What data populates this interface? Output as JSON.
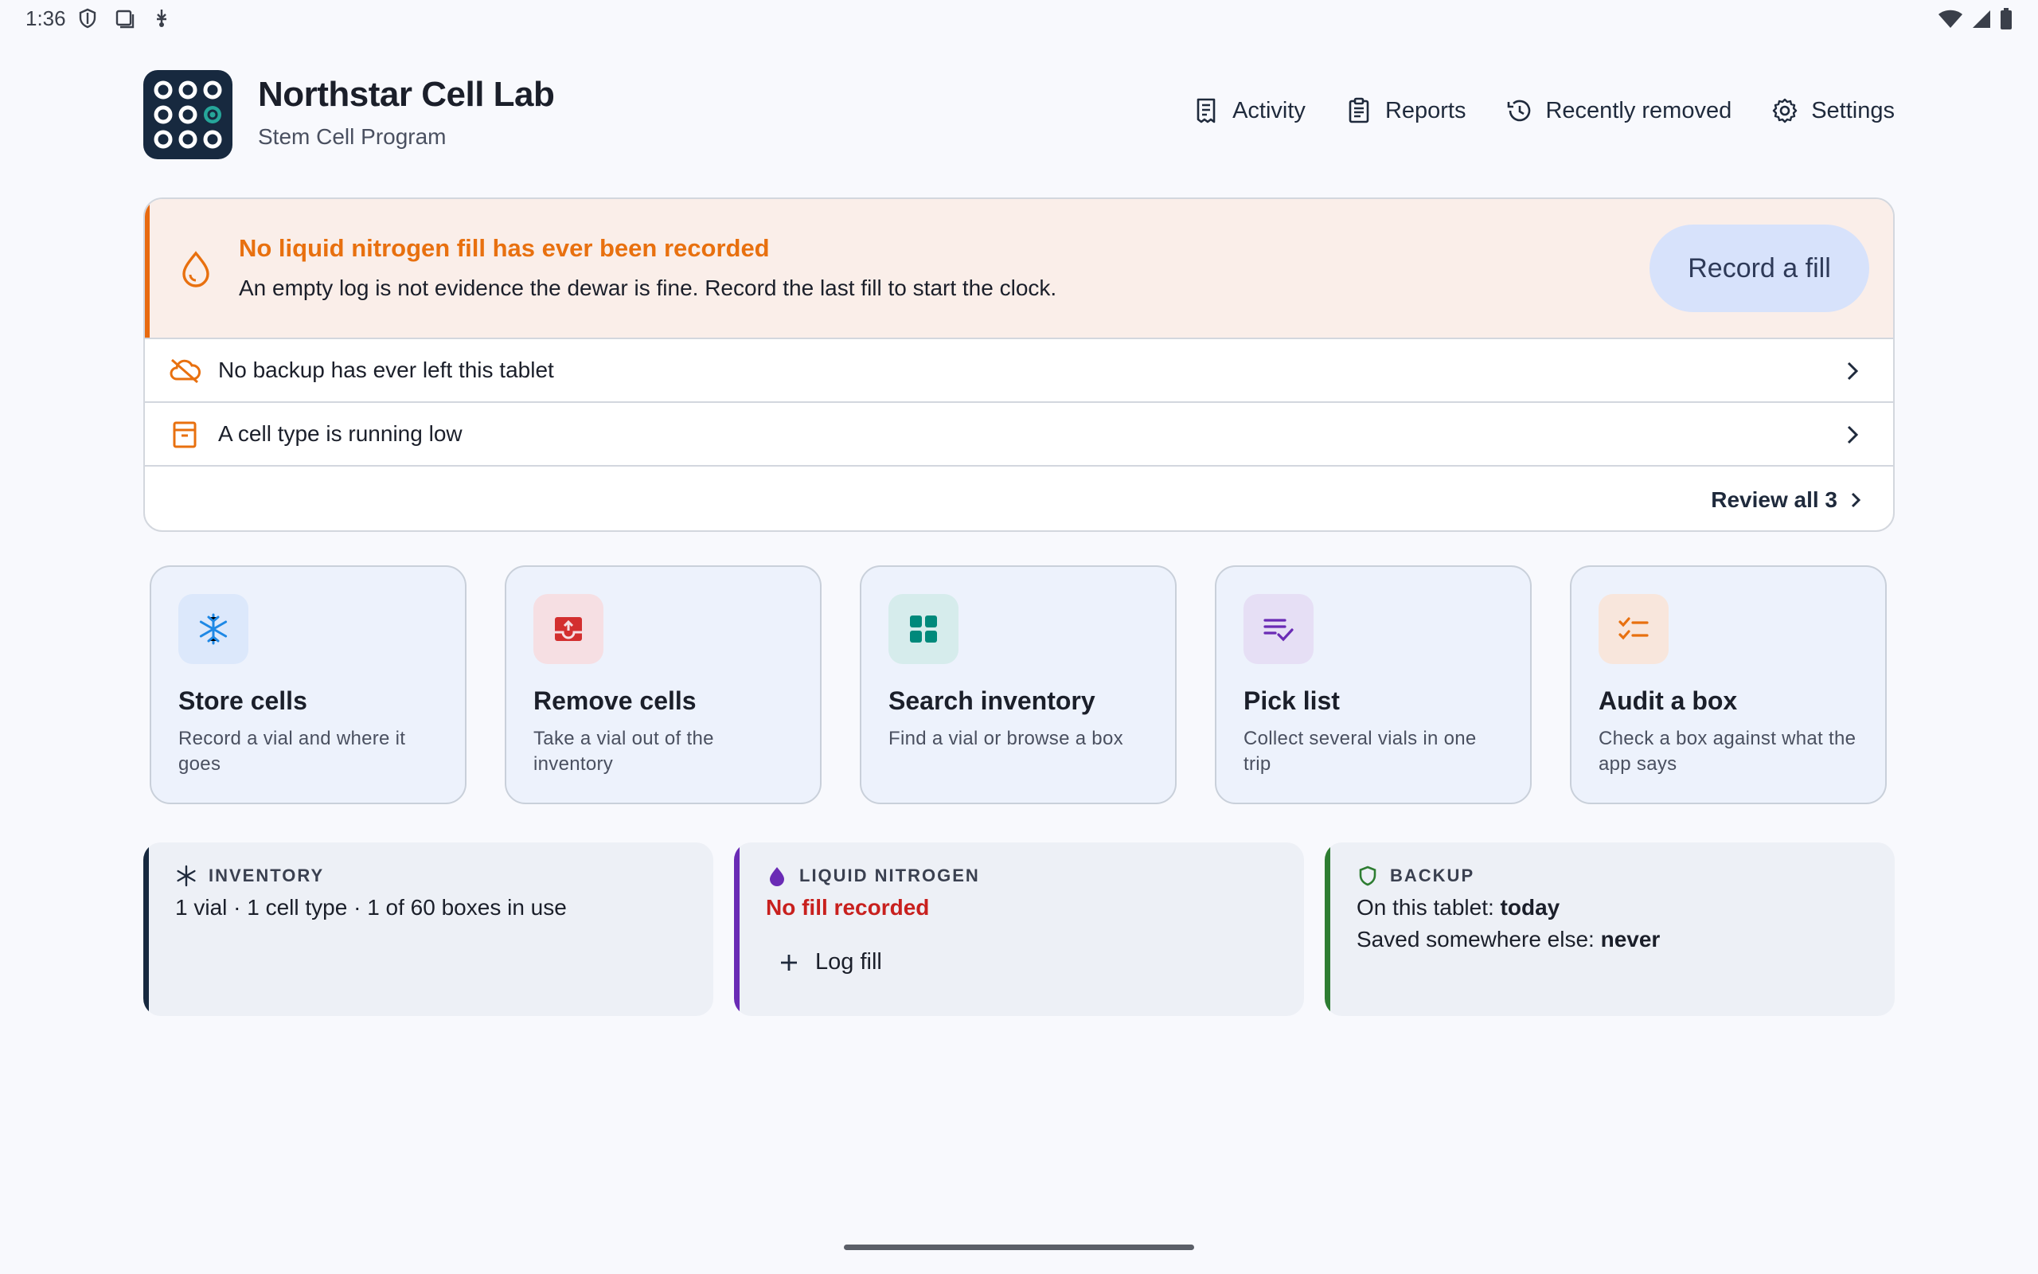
{
  "status_bar": {
    "time": "1:36"
  },
  "header": {
    "title": "Northstar Cell Lab",
    "subtitle": "Stem Cell Program",
    "nav": [
      {
        "label": "Activity",
        "icon": "receipt-icon"
      },
      {
        "label": "Reports",
        "icon": "clipboard-icon"
      },
      {
        "label": "Recently removed",
        "icon": "history-icon"
      },
      {
        "label": "Settings",
        "icon": "gear-icon"
      }
    ]
  },
  "alerts": {
    "main": {
      "title": "No liquid nitrogen fill has ever been recorded",
      "text": "An empty log is not evidence the dewar is fine. Record the last fill to start the clock.",
      "button": "Record a fill"
    },
    "rows": [
      {
        "label": "No backup has ever left this tablet",
        "icon": "cloud-off-icon"
      },
      {
        "label": "A cell type is running low",
        "icon": "archive-box-icon"
      }
    ],
    "review_all": "Review all 3"
  },
  "actions": [
    {
      "title": "Store cells",
      "desc": "Record a vial and where it goes",
      "icon": "snowflake-icon",
      "color": "#1e88e5",
      "bg": "#dce8fb"
    },
    {
      "title": "Remove cells",
      "desc": "Take a vial out of the inventory",
      "icon": "tray-out-icon",
      "color": "#d32f2f",
      "bg": "#f6dfe3"
    },
    {
      "title": "Search inventory",
      "desc": "Find a vial or browse a box",
      "icon": "grid-icon",
      "color": "#00897b",
      "bg": "#d6ecec"
    },
    {
      "title": "Pick list",
      "desc": "Collect several vials in one trip",
      "icon": "checklist-icon",
      "color": "#6a2bb5",
      "bg": "#e6dff5"
    },
    {
      "title": "Audit a box",
      "desc": "Check a box against what the app says",
      "icon": "audit-list-icon",
      "color": "#e8700f",
      "bg": "#f8e6dc"
    }
  ],
  "stats": {
    "inventory": {
      "heading": "INVENTORY",
      "line": "1 vial · 1 cell type · 1 of 60 boxes in use",
      "accent": "#17293f"
    },
    "nitrogen": {
      "heading": "LIQUID NITROGEN",
      "status": "No fill recorded",
      "action": "Log fill",
      "accent": "#6a2bb5"
    },
    "backup": {
      "heading": "BACKUP",
      "tablet_label": "On this tablet:",
      "tablet_value": "today",
      "else_label": "Saved somewhere else:",
      "else_value": "never",
      "accent": "#2e7d32"
    }
  }
}
